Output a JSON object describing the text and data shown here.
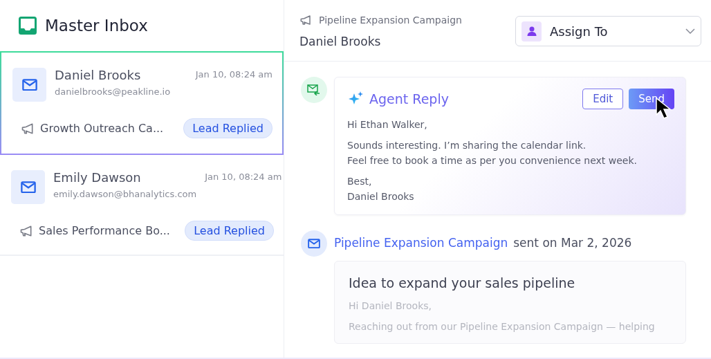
{
  "inbox": {
    "title": "Master Inbox",
    "items": [
      {
        "name": "Daniel Brooks",
        "email": "danielbrooks@peakline.io",
        "time": "Jan 10, 08:24 am",
        "campaign": "Growth Outreach Ca...",
        "status": "Lead Replied",
        "selected": true
      },
      {
        "name": "Emily Dawson",
        "email": "emily.dawson@bhanalytics.com",
        "time": "Jan 10, 08:24 am",
        "campaign": "Sales Performance Bo...",
        "status": "Lead Replied",
        "selected": false
      }
    ]
  },
  "conversation": {
    "campaign": "Pipeline Expansion Campaign",
    "contact": "Daniel Brooks",
    "assign": {
      "label": "Assign To"
    },
    "agent_reply": {
      "title": "Agent Reply",
      "buttons": {
        "edit": "Edit",
        "send": "Send"
      },
      "paragraphs": [
        [
          "Hi Ethan Walker,"
        ],
        [
          "Sounds interesting. I’m sharing the calendar link.",
          "Feel free to book a time as per you convenience next week."
        ],
        [
          "Best,",
          "Daniel Brooks"
        ]
      ]
    },
    "sent": {
      "campaign": "Pipeline Expansion Campaign",
      "info": "sent on Mar 2, 2026",
      "subject": "Idea to expand your sales pipeline",
      "lines": [
        "Hi Daniel Brooks,",
        "Reaching out from our Pipeline Expansion Campaign — helping"
      ]
    }
  }
}
